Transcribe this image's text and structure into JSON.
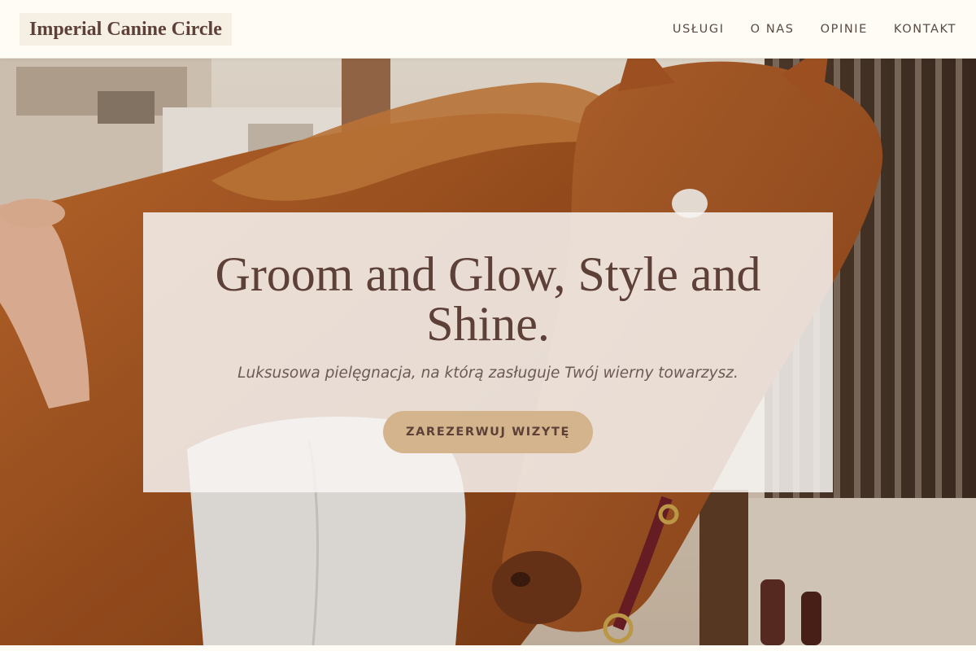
{
  "header": {
    "logo_text": "Imperial Canine Circle",
    "nav": [
      {
        "label": "USŁUGI"
      },
      {
        "label": "O NAS"
      },
      {
        "label": "OPINIE"
      },
      {
        "label": "KONTAKT"
      }
    ]
  },
  "hero": {
    "title": "Groom and Glow, Style and Shine.",
    "subtitle": "Luksusowa pielęgnacja, na którą zasługuje Twój wierny towarzysz.",
    "cta_label": "ZAREZERWUJ WIZYTĘ",
    "background_image": "horse-in-stable-photo"
  },
  "colors": {
    "brand_brown": "#5d4037",
    "accent_tan": "#d3b48c",
    "header_bg": "#fffcf6",
    "card_bg": "#f7f4f2"
  }
}
